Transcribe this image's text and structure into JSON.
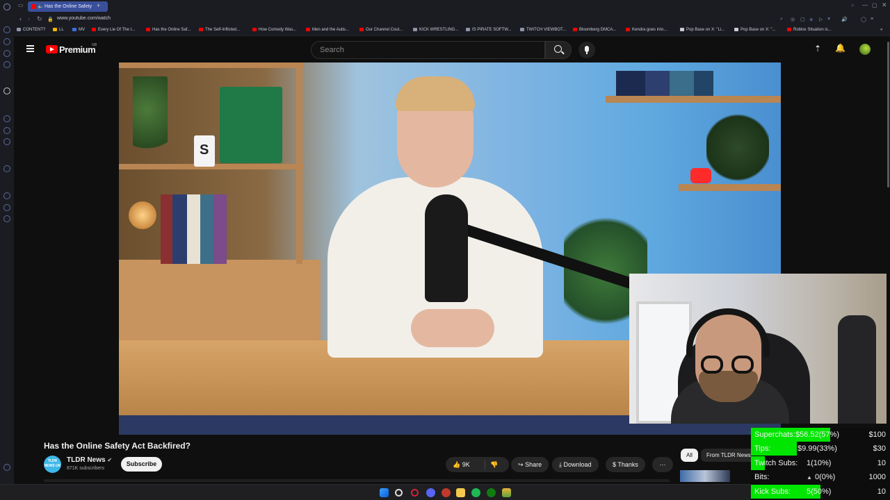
{
  "browser": {
    "tab_title": "Has the Online Safety",
    "url": "www.youtube.com/watch",
    "bookmarks": [
      "CONTENT?",
      "LL",
      "MV",
      "Every Lie Of The I...",
      "Has the Online Saf...",
      "The Self-Inflicted...",
      "How Comedy Was...",
      "Men and the Autis...",
      "Our Channel Coul...",
      "KICK WRESTLING...",
      "IS PIRATE SOFTW...",
      "TWITCH VIEWBOT...",
      "Bloomberg DMCA...",
      "Kendra goes into...",
      "Pop Base on X: \"Li...",
      "Pop Base on X: \"...",
      "Roblox Situation is..."
    ]
  },
  "youtube": {
    "logo": "Premium",
    "region": "GB",
    "search_placeholder": "Search",
    "video_title": "Has the Online Safety Act Backfired?",
    "channel": {
      "name": "TLDR News",
      "avatar_text": "TLDR NEWS UK",
      "subscribers": "871K subscribers"
    },
    "subscribe_label": "Subscribe",
    "likes": "9K",
    "share_label": "Share",
    "download_label": "Download",
    "thanks_label": "Thanks",
    "chips": [
      "All",
      "From TLDR News"
    ]
  },
  "stats": [
    {
      "label": "Superchats:",
      "value": "$56.52(57%)",
      "goal": "$100",
      "fill": 0.57
    },
    {
      "label": "Tips:",
      "value": "$9.99(33%)",
      "goal": "$30",
      "fill": 0.33
    },
    {
      "label": "Twitch Subs:",
      "value": "1(10%)",
      "goal": "10",
      "fill": 0.1
    },
    {
      "label": "Bits:",
      "value": "0(0%)",
      "goal": "1000",
      "fill": 0.0
    },
    {
      "label": "Kick Subs:",
      "value": "5(50%)",
      "goal": "10",
      "fill": 0.5
    }
  ],
  "colors": {
    "youtube_red": "#ff0000",
    "stats_bar": "#00e600",
    "tab_active": "#3a4f9a"
  }
}
